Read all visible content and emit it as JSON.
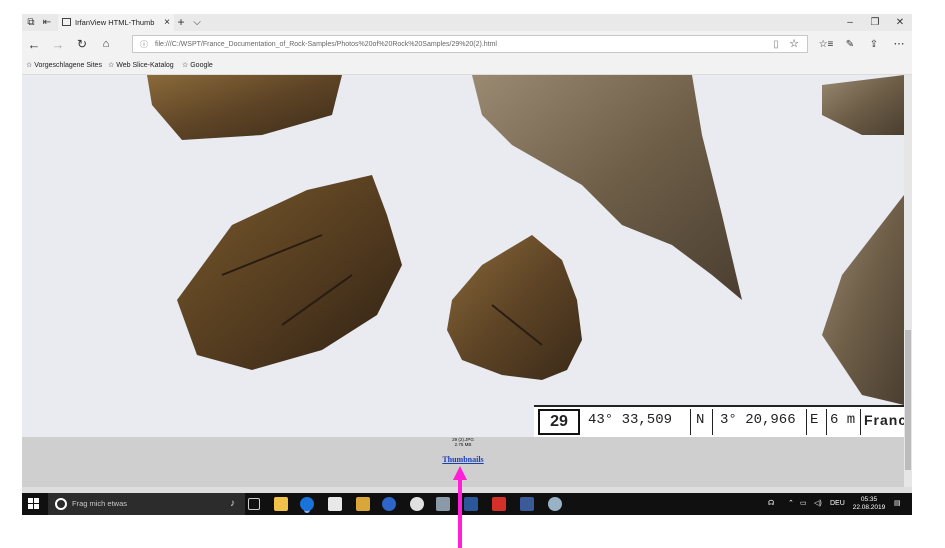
{
  "browser": {
    "tab": {
      "title": "IrfanView HTML-Thumb",
      "close_icon": "close-icon"
    },
    "new_tab_icon": "plus-icon",
    "tab_list_icon": "chevron-down-icon",
    "window_controls": {
      "minimize": "–",
      "restore": "❐",
      "close": "✕"
    },
    "url": "file:///C:/WSPT/France_Documentation_of_Rock-Samples/Photos%20of%20Rock%20Samples/29%20(2).html",
    "favorites": [
      {
        "label": "Vorgeschlagene Sites"
      },
      {
        "label": "Web Slice-Katalog"
      },
      {
        "label": "Google"
      }
    ]
  },
  "page": {
    "photo": {
      "sample_number": "29",
      "latitude": "43° 33,509",
      "lat_dir": "N",
      "longitude": "3°  20,966",
      "lon_dir": "E",
      "elevation": "6 m",
      "country": "France -"
    },
    "file_name": "29 (2).JPG",
    "file_size": "2.75 MB",
    "thumbnails_link": "Thumbnails"
  },
  "taskbar": {
    "search_placeholder": "Frag mich etwas",
    "language": "DEU",
    "time": "05:35",
    "date": "22.08.2019"
  },
  "colors": {
    "annotation_arrow": "#ff1fd6",
    "link": "#1a3fb4",
    "taskbar": "#101010"
  }
}
